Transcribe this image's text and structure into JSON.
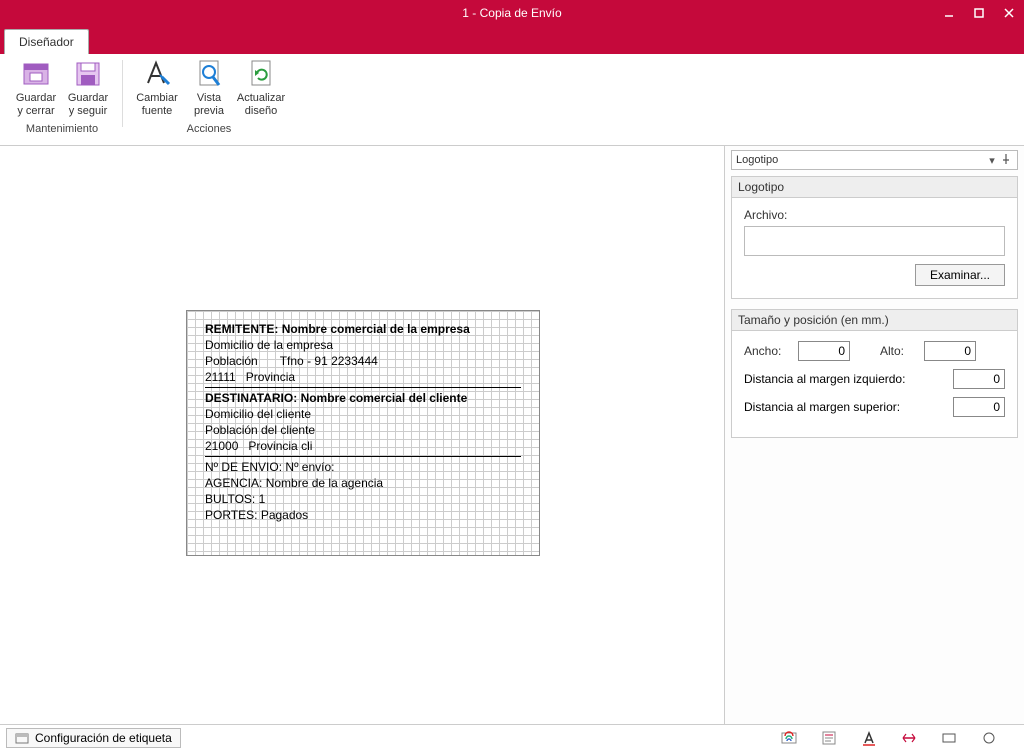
{
  "window": {
    "title": "1 - Copia de Envío"
  },
  "tabs": {
    "designer": "Diseñador"
  },
  "ribbon": {
    "guardar_cerrar": "Guardar y cerrar",
    "guardar_seguir": "Guardar y seguir",
    "cambiar_fuente": "Cambiar fuente",
    "vista_previa": "Vista previa",
    "actualizar_diseno": "Actualizar diseño",
    "group_mantenimiento": "Mantenimiento",
    "group_acciones": "Acciones"
  },
  "label": {
    "remitente_label": "REMITENTE:",
    "remitente_value": "Nombre comercial de la empresa",
    "remitente_domicilio": "Domicilio de la empresa",
    "remitente_poblacion": "Población",
    "remitente_tfno": "Tfno - 91 2233444",
    "remitente_cp": "21111",
    "remitente_provincia": "Provincia",
    "destinatario_label": "DESTINATARIO:",
    "destinatario_value": "Nombre comercial del cliente",
    "destinatario_domicilio": "Domicilio del cliente",
    "destinatario_poblacion": "Población del cliente",
    "destinatario_cp": "21000",
    "destinatario_provincia": "Provincia cli",
    "n_envio_label": "Nº DE ENVIO:",
    "n_envio_value": "Nº envío:",
    "agencia_label": "AGENCIA:",
    "agencia_value": "Nombre de la agencia",
    "bultos_label": "BULTOS:",
    "bultos_value": "1",
    "portes_label": "PORTES:",
    "portes_value": "Pagados"
  },
  "panel": {
    "dropdown": "Logotipo",
    "logotipo": {
      "title": "Logotipo",
      "archivo_label": "Archivo:",
      "archivo_value": "",
      "examinar": "Examinar..."
    },
    "tamano": {
      "title": "Tamaño y posición (en mm.)",
      "ancho_label": "Ancho:",
      "ancho_value": "0",
      "alto_label": "Alto:",
      "alto_value": "0",
      "dist_izq_label": "Distancia al margen izquierdo:",
      "dist_izq_value": "0",
      "dist_sup_label": "Distancia al margen superior:",
      "dist_sup_value": "0"
    }
  },
  "status": {
    "config_label": "Configuración de etiqueta"
  }
}
